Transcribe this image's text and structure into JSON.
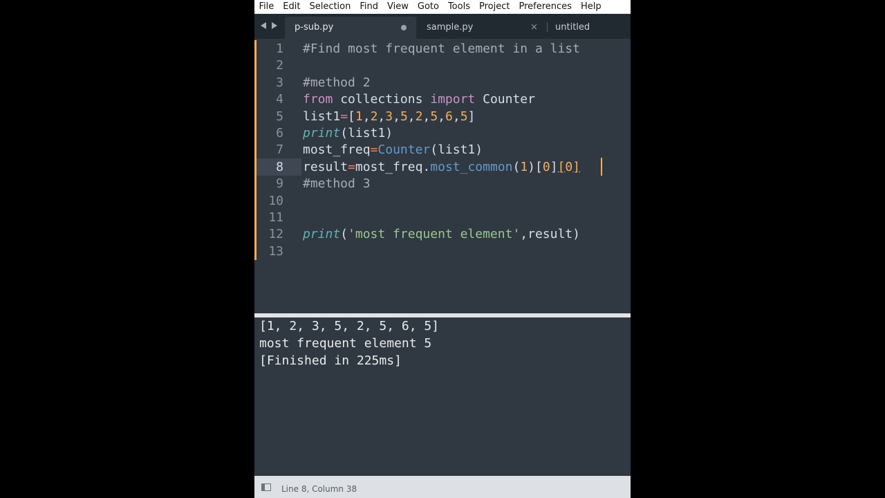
{
  "menu": [
    "File",
    "Edit",
    "Selection",
    "Find",
    "View",
    "Goto",
    "Tools",
    "Project",
    "Preferences",
    "Help"
  ],
  "tabs": [
    {
      "label": "p-sub.py",
      "active": true,
      "dirty": true
    },
    {
      "label": "sample.py",
      "close": "×"
    },
    {
      "label": "untitled"
    }
  ],
  "editor": {
    "current_line": 8,
    "lines": [
      {
        "n": "1",
        "tokens": [
          {
            "t": "#Find most frequent element in a list",
            "c": "comment"
          }
        ]
      },
      {
        "n": "2",
        "tokens": []
      },
      {
        "n": "3",
        "tokens": [
          {
            "t": "#method 2",
            "c": "comment"
          }
        ]
      },
      {
        "n": "4",
        "tokens": [
          {
            "t": "from",
            "c": "kw"
          },
          {
            "t": " collections ",
            "c": "ident"
          },
          {
            "t": "import",
            "c": "kw"
          },
          {
            "t": " Counter",
            "c": "ident"
          }
        ]
      },
      {
        "n": "5",
        "tokens": [
          {
            "t": "list1",
            "c": "ident"
          },
          {
            "t": "=",
            "c": "op"
          },
          {
            "t": "[",
            "c": "punct"
          },
          {
            "t": "1",
            "c": "num"
          },
          {
            "t": ",",
            "c": "punct"
          },
          {
            "t": "2",
            "c": "num"
          },
          {
            "t": ",",
            "c": "punct"
          },
          {
            "t": "3",
            "c": "num"
          },
          {
            "t": ",",
            "c": "punct"
          },
          {
            "t": "5",
            "c": "num"
          },
          {
            "t": ",",
            "c": "punct"
          },
          {
            "t": "2",
            "c": "num"
          },
          {
            "t": ",",
            "c": "punct"
          },
          {
            "t": "5",
            "c": "num"
          },
          {
            "t": ",",
            "c": "punct"
          },
          {
            "t": "6",
            "c": "num"
          },
          {
            "t": ",",
            "c": "punct"
          },
          {
            "t": "5",
            "c": "num"
          },
          {
            "t": "]",
            "c": "punct"
          }
        ]
      },
      {
        "n": "6",
        "tokens": [
          {
            "t": "print",
            "c": "func"
          },
          {
            "t": "(list1)",
            "c": "punct"
          }
        ]
      },
      {
        "n": "7",
        "tokens": [
          {
            "t": "most_freq",
            "c": "ident"
          },
          {
            "t": "=",
            "c": "op"
          },
          {
            "t": "Counter",
            "c": "call"
          },
          {
            "t": "(list1)",
            "c": "punct"
          }
        ]
      },
      {
        "n": "8",
        "tokens": [
          {
            "t": "result",
            "c": "ident"
          },
          {
            "t": "=",
            "c": "op"
          },
          {
            "t": "most_freq",
            "c": "ident"
          },
          {
            "t": ".",
            "c": "punct"
          },
          {
            "t": "most_common",
            "c": "call"
          },
          {
            "t": "(",
            "c": "punct"
          },
          {
            "t": "1",
            "c": "num"
          },
          {
            "t": ")[",
            "c": "punct"
          },
          {
            "t": "0",
            "c": "num"
          },
          {
            "t": "]",
            "c": "punct"
          },
          {
            "t": "[",
            "c": "bracket-hl"
          },
          {
            "t": "0",
            "c": "num"
          },
          {
            "t": "]",
            "c": "bracket-hl"
          }
        ]
      },
      {
        "n": "9",
        "tokens": [
          {
            "t": "#method 3",
            "c": "comment"
          }
        ]
      },
      {
        "n": "10",
        "tokens": []
      },
      {
        "n": "11",
        "tokens": []
      },
      {
        "n": "12",
        "tokens": [
          {
            "t": "print",
            "c": "func"
          },
          {
            "t": "(",
            "c": "punct"
          },
          {
            "t": "'most frequent element'",
            "c": "str"
          },
          {
            "t": ",result)",
            "c": "punct"
          }
        ]
      },
      {
        "n": "13",
        "tokens": []
      }
    ]
  },
  "output": {
    "lines": [
      "[1, 2, 3, 5, 2, 5, 6, 5]",
      "most frequent element 5",
      "[Finished in 225ms]"
    ]
  },
  "status": {
    "text": "Line 8, Column 38"
  },
  "colors": {
    "background": "#303841",
    "accent": "#f9ae58",
    "keyword": "#c594c5",
    "number": "#f9ae58",
    "string": "#99c794",
    "function": "#5fb4b4",
    "call": "#6699cc",
    "operator": "#f97b58"
  }
}
